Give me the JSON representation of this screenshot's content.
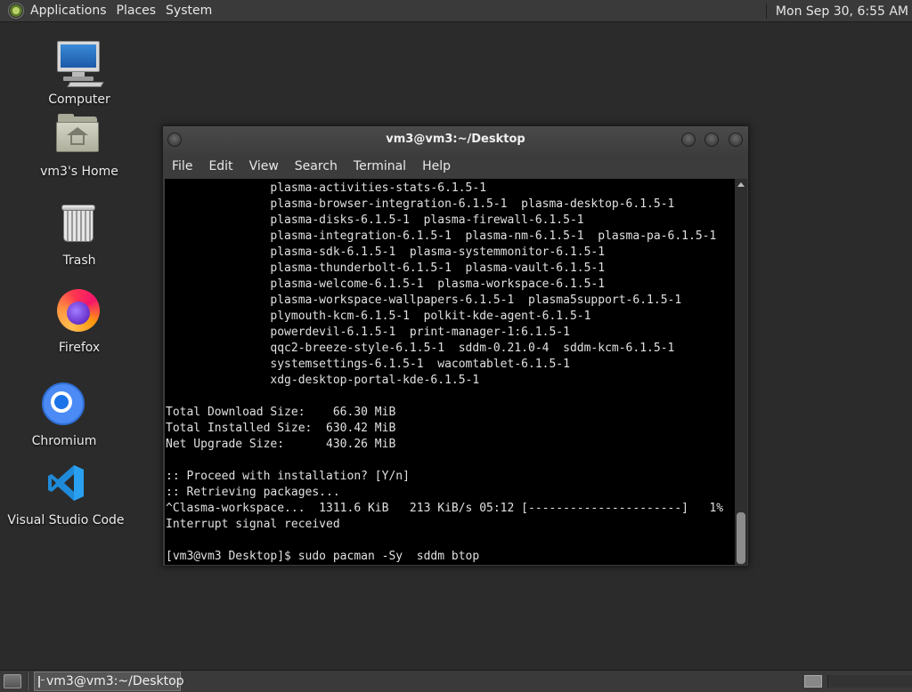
{
  "top_panel": {
    "menus": [
      "Applications",
      "Places",
      "System"
    ],
    "clock": "Mon Sep 30,  6:55 AM"
  },
  "desktop": {
    "icons": [
      {
        "label": "Computer",
        "icon": "computer-icon"
      },
      {
        "label": "vm3's Home",
        "icon": "home-folder-icon"
      },
      {
        "label": "Trash",
        "icon": "trash-icon"
      },
      {
        "label": "Firefox",
        "icon": "firefox-icon"
      },
      {
        "label": "Chromium",
        "icon": "chromium-icon"
      },
      {
        "label": "Visual Studio Code",
        "icon": "vscode-icon"
      }
    ]
  },
  "terminal": {
    "title": "vm3@vm3:~/Desktop",
    "menu": [
      "File",
      "Edit",
      "View",
      "Search",
      "Terminal",
      "Help"
    ],
    "lines": [
      "               plasma-activities-stats-6.1.5-1",
      "               plasma-browser-integration-6.1.5-1  plasma-desktop-6.1.5-1",
      "               plasma-disks-6.1.5-1  plasma-firewall-6.1.5-1",
      "               plasma-integration-6.1.5-1  plasma-nm-6.1.5-1  plasma-pa-6.1.5-1",
      "               plasma-sdk-6.1.5-1  plasma-systemmonitor-6.1.5-1",
      "               plasma-thunderbolt-6.1.5-1  plasma-vault-6.1.5-1",
      "               plasma-welcome-6.1.5-1  plasma-workspace-6.1.5-1",
      "               plasma-workspace-wallpapers-6.1.5-1  plasma5support-6.1.5-1",
      "               plymouth-kcm-6.1.5-1  polkit-kde-agent-6.1.5-1",
      "               powerdevil-6.1.5-1  print-manager-1:6.1.5-1",
      "               qqc2-breeze-style-6.1.5-1  sddm-0.21.0-4  sddm-kcm-6.1.5-1",
      "               systemsettings-6.1.5-1  wacomtablet-6.1.5-1",
      "               xdg-desktop-portal-kde-6.1.5-1",
      "",
      "Total Download Size:    66.30 MiB",
      "Total Installed Size:  630.42 MiB",
      "Net Upgrade Size:      430.26 MiB",
      "",
      ":: Proceed with installation? [Y/n]",
      ":: Retrieving packages...",
      "^Clasma-workspace...  1311.6 KiB   213 KiB/s 05:12 [----------------------]   1%",
      "Interrupt signal received",
      "",
      "[vm3@vm3 Desktop]$ sudo pacman -Sy  sddm btop"
    ]
  },
  "taskbar": {
    "task_label": "vm3@vm3:~/Desktop"
  }
}
